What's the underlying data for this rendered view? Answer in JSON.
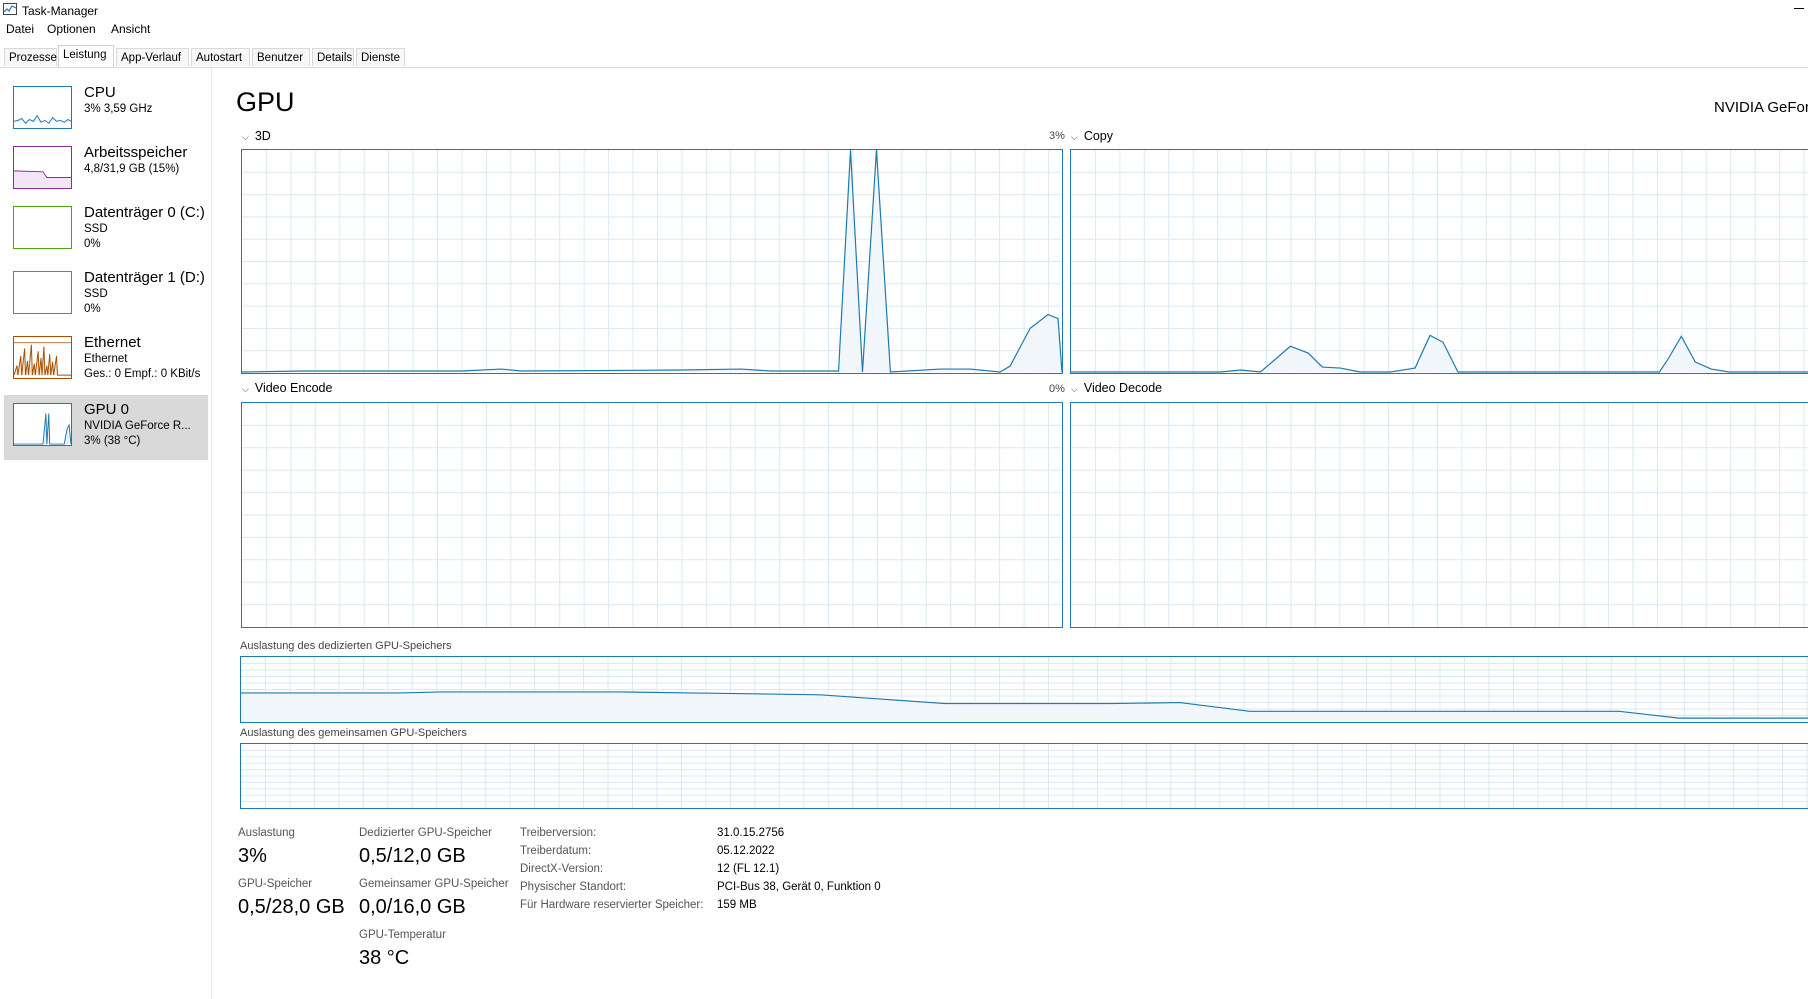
{
  "window": {
    "title": "Task-Manager"
  },
  "menu": [
    "Datei",
    "Optionen",
    "Ansicht"
  ],
  "tabs": [
    "Prozesse",
    "Leistung",
    "App-Verlauf",
    "Autostart",
    "Benutzer",
    "Details",
    "Dienste"
  ],
  "active_tab": "Leistung",
  "sidebar": {
    "items": [
      {
        "title": "CPU",
        "line1": "3%  3,59 GHz",
        "line2": "",
        "color": "#1d7ab0"
      },
      {
        "title": "Arbeitsspeicher",
        "line1": "4,8/31,9 GB (15%)",
        "line2": "",
        "color": "#8b2d96"
      },
      {
        "title": "Datenträger 0 (C:)",
        "line1": "SSD",
        "line2": "0%",
        "color": "#4da60c"
      },
      {
        "title": "Datenträger 1 (D:)",
        "line1": "SSD",
        "line2": "0%",
        "color": "#4da60c"
      },
      {
        "title": "Ethernet",
        "line1": "Ethernet",
        "line2": "Ges.: 0  Empf.: 0 KBit/s",
        "color": "#a74f01"
      },
      {
        "title": "GPU 0",
        "line1": "NVIDIA GeForce R...",
        "line2": "3% (38 °C)",
        "color": "#1d7ab0"
      }
    ],
    "selected_index": 5
  },
  "main": {
    "title": "GPU",
    "gpu_name": "NVIDIA GeFor",
    "panels": [
      {
        "label": "3D",
        "percent": "3%"
      },
      {
        "label": "Copy",
        "percent": ""
      },
      {
        "label": "Video Encode",
        "percent": "0%"
      },
      {
        "label": "Video Decode",
        "percent": ""
      }
    ],
    "dedicated_memory_label": "Auslastung des dedizierten GPU-Speichers",
    "shared_memory_label": "Auslastung des gemeinsamen GPU-Speichers"
  },
  "stats": {
    "auslastung_label": "Auslastung",
    "auslastung_value": "3%",
    "gpu_speicher_label": "GPU-Speicher",
    "gpu_speicher_value": "0,5/28,0 GB",
    "dedicated_label": "Dedizierter GPU-Speicher",
    "dedicated_value": "0,5/12,0 GB",
    "shared_label": "Gemeinsamer GPU-Speicher",
    "shared_value": "0,0/16,0 GB",
    "temp_label": "GPU-Temperatur",
    "temp_value": "38 °C"
  },
  "info": [
    {
      "key": "Treiberversion:",
      "value": "31.0.15.2756"
    },
    {
      "key": "Treiberdatum:",
      "value": "05.12.2022"
    },
    {
      "key": "DirectX-Version:",
      "value": "12 (FL 12.1)"
    },
    {
      "key": "Physischer Standort:",
      "value": "PCI-Bus 38, Gerät 0, Funktion 0"
    },
    {
      "key": "Für Hardware reservierter Speicher:",
      "value": "159 MB"
    }
  ],
  "colors": {
    "gpu_line": "#1d7ab0",
    "grid": "#d9eaf5",
    "fill": "#f1f6fb",
    "selected_bg": "#d9d9d9"
  }
}
